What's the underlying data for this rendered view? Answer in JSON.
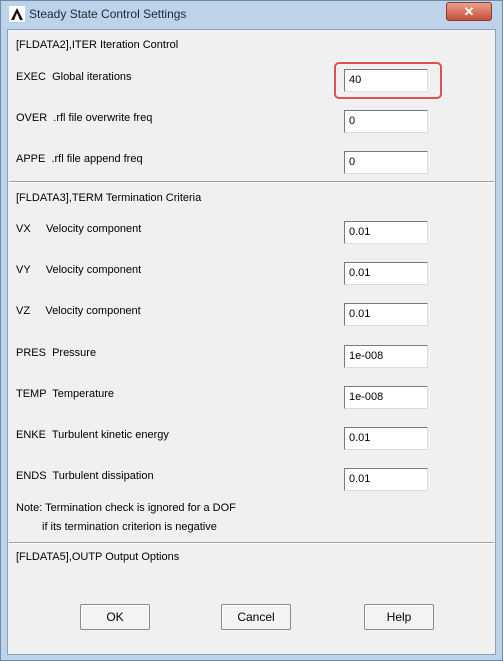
{
  "window": {
    "title": "Steady State Control Settings",
    "close_symbol": "✕"
  },
  "iteration": {
    "header": "[FLDATA2],ITER   Iteration Control",
    "fields": [
      {
        "label": "EXEC  Global iterations",
        "value": "40"
      },
      {
        "label": "OVER  .rfl file overwrite freq",
        "value": "0"
      },
      {
        "label": "APPE  .rfl file append freq",
        "value": "0"
      }
    ]
  },
  "termination": {
    "header": "[FLDATA3],TERM   Termination Criteria",
    "fields": [
      {
        "label": "VX     Velocity component",
        "value": "0.01"
      },
      {
        "label": "VY     Velocity component",
        "value": "0.01"
      },
      {
        "label": "VZ     Velocity component",
        "value": "0.01"
      },
      {
        "label": "PRES  Pressure",
        "value": "1e-008"
      },
      {
        "label": "TEMP  Temperature",
        "value": "1e-008"
      },
      {
        "label": "ENKE  Turbulent kinetic energy",
        "value": "0.01"
      },
      {
        "label": "ENDS  Turbulent dissipation",
        "value": "0.01"
      }
    ],
    "note_line1": "Note:  Termination check is ignored for a DOF",
    "note_line2": "if its termination criterion is negative"
  },
  "output": {
    "header": "[FLDATA5],OUTP   Output Options"
  },
  "buttons": {
    "ok": "OK",
    "cancel": "Cancel",
    "help": "Help"
  }
}
